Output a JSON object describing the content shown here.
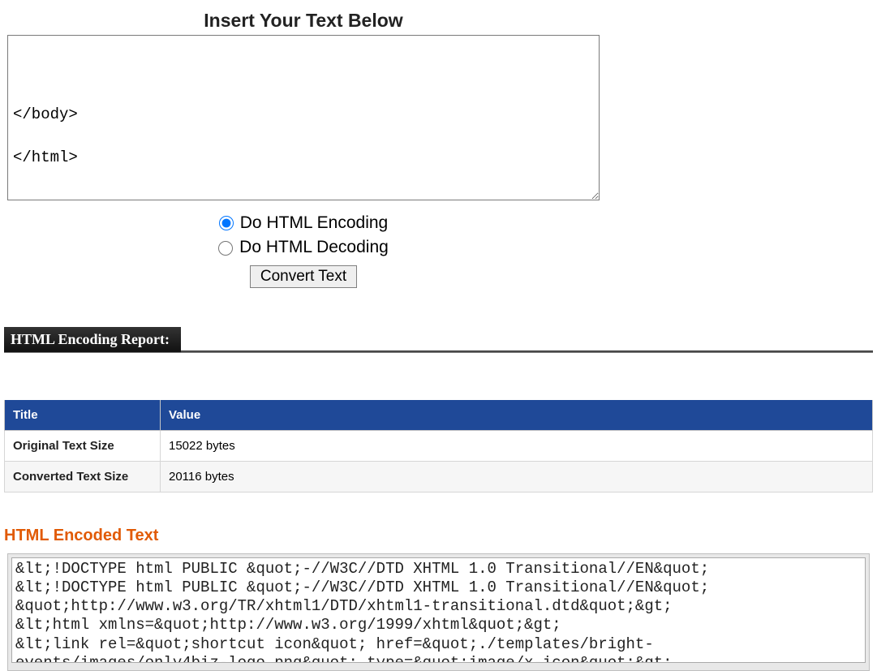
{
  "heading": "Insert Your Text Below",
  "input_text": "\n\n\n</body>\n\n</html>",
  "radios": {
    "encode_label": "Do HTML Encoding",
    "decode_label": "Do HTML Decoding",
    "selected": "encode"
  },
  "button_label": "Convert Text",
  "report": {
    "header": "HTML Encoding Report:",
    "columns": [
      "Title",
      "Value"
    ],
    "rows": [
      {
        "title": "Original Text Size",
        "value": "15022 bytes"
      },
      {
        "title": "Converted Text Size",
        "value": "20116 bytes"
      }
    ]
  },
  "encoded_heading": "HTML Encoded Text",
  "encoded_text": "&lt;!DOCTYPE html PUBLIC &quot;-//W3C//DTD XHTML 1.0 Transitional//EN&quot;\n&lt;!DOCTYPE html PUBLIC &quot;-//W3C//DTD XHTML 1.0 Transitional//EN&quot;\n&quot;http://www.w3.org/TR/xhtml1/DTD/xhtml1-transitional.dtd&quot;&gt;\n&lt;html xmlns=&quot;http://www.w3.org/1999/xhtml&quot;&gt;\n&lt;link rel=&quot;shortcut icon&quot; href=&quot;./templates/bright-events/images/only4biz-logo.png&quot; type=&quot;image/x-icon&quot;&gt;"
}
